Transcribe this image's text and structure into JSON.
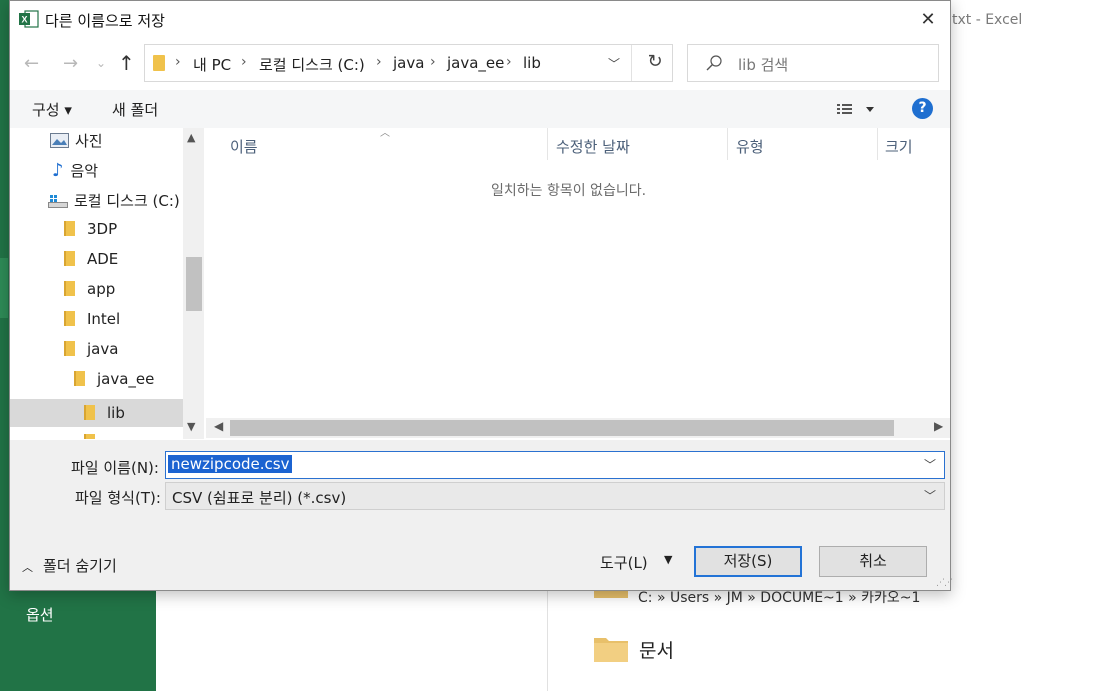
{
  "background": {
    "window_title_partial": "txt - Excel",
    "options_label": "옵션",
    "recent_path": "C: » Users » JM » DOCUME~1 » 카카오~1",
    "documents_label": "문서"
  },
  "dialog": {
    "title": "다른 이름으로 저장",
    "close_label": "✕"
  },
  "nav": {
    "back_icon": "←",
    "forward_icon": "→",
    "recent_icon": "⌄",
    "up_icon": "↑",
    "breadcrumb": [
      "내 PC",
      "로컬 디스크 (C:)",
      "java",
      "java_ee",
      "lib"
    ],
    "refresh_icon": "↻",
    "search_placeholder": "lib 검색"
  },
  "toolbar": {
    "organize_label": "구성 ▾",
    "new_folder_label": "새 폴더",
    "help_label": "?"
  },
  "tree": {
    "items": [
      {
        "label": "사진",
        "icon": "pictures-icon"
      },
      {
        "label": "음악",
        "icon": "music-icon"
      },
      {
        "label": "로컬 디스크 (C:)",
        "icon": "drive-icon"
      },
      {
        "label": "3DP",
        "icon": "folder-icon"
      },
      {
        "label": "ADE",
        "icon": "folder-icon"
      },
      {
        "label": "app",
        "icon": "folder-icon"
      },
      {
        "label": "Intel",
        "icon": "folder-icon"
      },
      {
        "label": "java",
        "icon": "folder-icon"
      },
      {
        "label": "java_ee",
        "icon": "folder-icon"
      },
      {
        "label": "lib",
        "icon": "folder-icon",
        "selected": true
      }
    ]
  },
  "filelist": {
    "columns": [
      "이름",
      "수정한 날짜",
      "유형",
      "크기"
    ],
    "empty_message": "일치하는 항목이 없습니다."
  },
  "form": {
    "filename_label": "파일 이름(N):",
    "filename_value": "newzipcode.csv",
    "filetype_label": "파일 형식(T):",
    "filetype_value": "CSV (쉼표로 분리) (*.csv)"
  },
  "footer": {
    "hide_folders_label": "폴더 숨기기",
    "tools_label": "도구(L)",
    "save_label": "저장(S)",
    "cancel_label": "취소"
  }
}
